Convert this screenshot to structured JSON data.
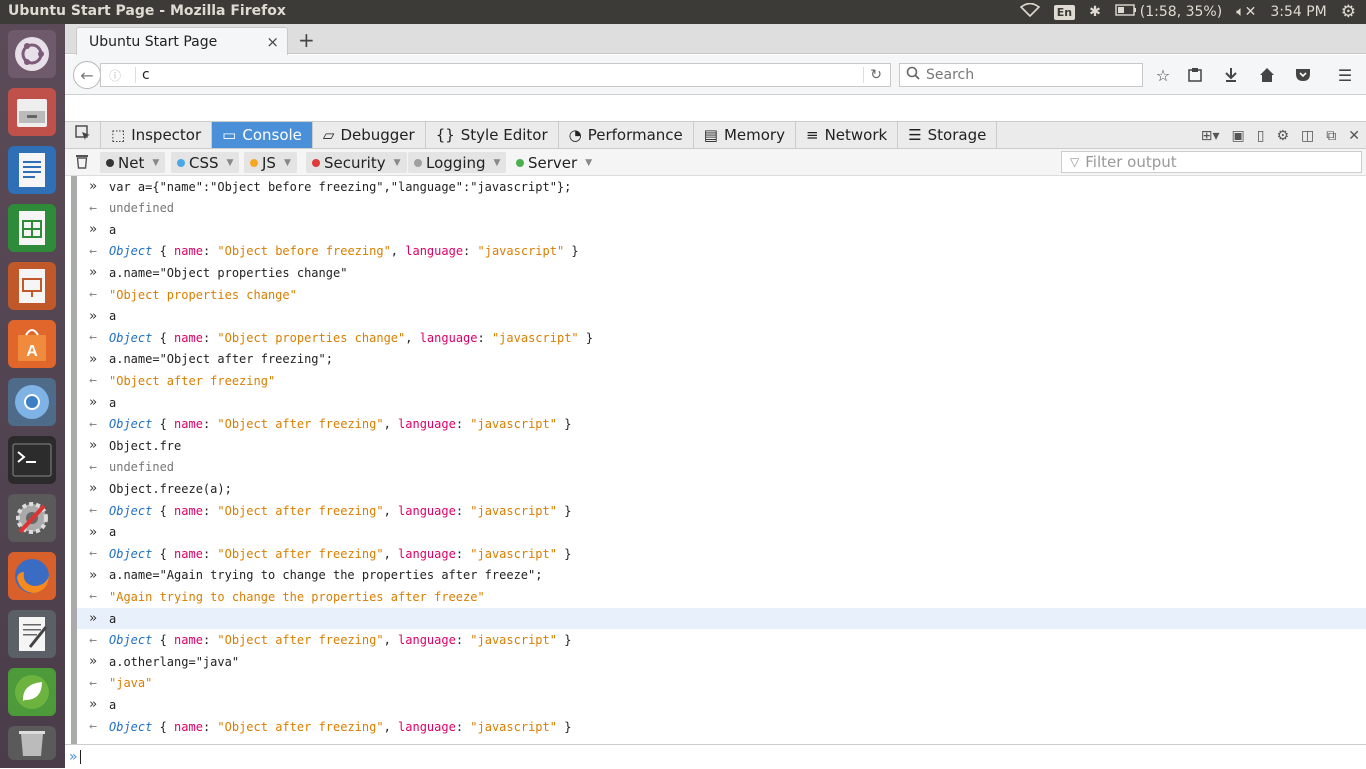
{
  "topbar": {
    "title": "Ubuntu Start Page - Mozilla Firefox",
    "keyboard": "En",
    "battery": "(1:58, 35%)",
    "time": "3:54 PM"
  },
  "launcher": {
    "items": [
      "ubuntu-dash",
      "files",
      "writer",
      "calc",
      "impress",
      "software-center",
      "chromium",
      "terminal",
      "system-settings",
      "firefox",
      "text-editor",
      "spring",
      "trash"
    ]
  },
  "browser": {
    "tab_title": "Ubuntu Start Page",
    "tab_close": "×",
    "new_tab": "+",
    "url": "c",
    "search_placeholder": "Search"
  },
  "devtools": {
    "tabs": [
      "Inspector",
      "Console",
      "Debugger",
      "Style Editor",
      "Performance",
      "Memory",
      "Network",
      "Storage"
    ],
    "selected_tab": "Console",
    "filters": [
      {
        "label": "Net",
        "color": "#333333"
      },
      {
        "label": "CSS",
        "color": "#4aa8e6"
      },
      {
        "label": "JS",
        "color": "#f5a623"
      },
      {
        "label": "Security",
        "color": "#e03a3a"
      },
      {
        "label": "Logging",
        "color": "#a0a0a0"
      },
      {
        "label": "Server",
        "color": "#4caf50"
      }
    ],
    "filter_placeholder": "Filter output"
  },
  "console": {
    "lines": [
      {
        "type": "in",
        "text": "var a={\"name\":\"Object before freezing\",\"language\":\"javascript\"};"
      },
      {
        "type": "out",
        "kind": "undef",
        "text": "undefined"
      },
      {
        "type": "in",
        "text": "a"
      },
      {
        "type": "out",
        "kind": "obj",
        "name": "Object before freezing",
        "lang": "javascript"
      },
      {
        "type": "in",
        "text": "a.name=\"Object properties change\""
      },
      {
        "type": "out",
        "kind": "str",
        "text": "\"Object properties change\""
      },
      {
        "type": "in",
        "text": "a"
      },
      {
        "type": "out",
        "kind": "obj",
        "name": "Object properties change",
        "lang": "javascript"
      },
      {
        "type": "in",
        "text": "a.name=\"Object after freezing\";"
      },
      {
        "type": "out",
        "kind": "str",
        "text": "\"Object after freezing\""
      },
      {
        "type": "in",
        "text": "a"
      },
      {
        "type": "out",
        "kind": "obj",
        "name": "Object after freezing",
        "lang": "javascript"
      },
      {
        "type": "in",
        "text": "Object.fre"
      },
      {
        "type": "out",
        "kind": "undef",
        "text": "undefined"
      },
      {
        "type": "in",
        "text": "Object.freeze(a);"
      },
      {
        "type": "out",
        "kind": "obj",
        "name": "Object after freezing",
        "lang": "javascript"
      },
      {
        "type": "in",
        "text": "a"
      },
      {
        "type": "out",
        "kind": "obj",
        "name": "Object after freezing",
        "lang": "javascript"
      },
      {
        "type": "in",
        "text": "a.name=\"Again trying to change the properties after freeze\";"
      },
      {
        "type": "out",
        "kind": "str",
        "text": "\"Again trying to change the properties after freeze\""
      },
      {
        "type": "in",
        "text": "a",
        "highlight": true
      },
      {
        "type": "out",
        "kind": "obj",
        "name": "Object after freezing",
        "lang": "javascript"
      },
      {
        "type": "in",
        "text": "a.otherlang=\"java\""
      },
      {
        "type": "out",
        "kind": "str",
        "text": "\"java\""
      },
      {
        "type": "in",
        "text": "a"
      },
      {
        "type": "out",
        "kind": "obj",
        "name": "Object after freezing",
        "lang": "javascript"
      }
    ],
    "in_prompt": "»",
    "out_prompt": "←",
    "obj_label": "Object",
    "key_name": "name",
    "key_lang": "language"
  }
}
